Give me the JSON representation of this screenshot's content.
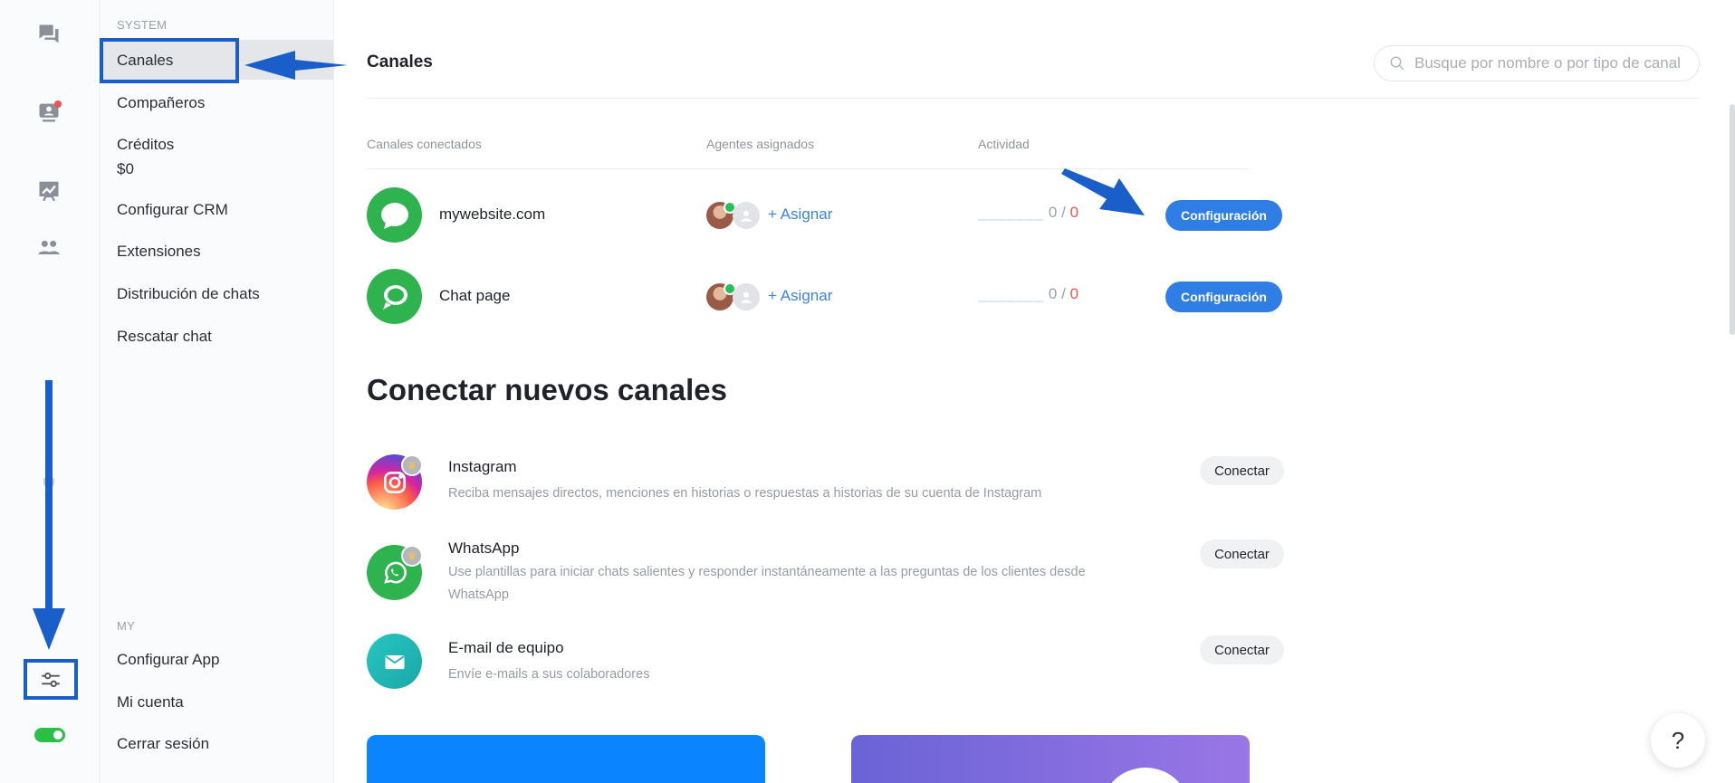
{
  "menu": {
    "system_label": "SYSTEM",
    "items": [
      {
        "label": "Canales"
      },
      {
        "label": "Compañeros"
      },
      {
        "label": "Créditos"
      },
      {
        "label": "Configurar CRM"
      },
      {
        "label": "Extensiones"
      },
      {
        "label": "Distribución de chats"
      },
      {
        "label": "Rescatar chat"
      }
    ],
    "credits_value": "$0",
    "my_label": "MY",
    "my_items": [
      {
        "label": "Configurar App"
      },
      {
        "label": "Mi cuenta"
      },
      {
        "label": "Cerrar sesión"
      }
    ]
  },
  "header": {
    "title": "Canales",
    "search_placeholder": "Busque por nombre o por tipo de canal"
  },
  "table": {
    "columns": [
      "Canales conectados",
      "Agentes asignados",
      "Actividad"
    ],
    "rows": [
      {
        "name": "mywebsite.com",
        "assign": "+ Asignar",
        "dashes": "_______",
        "count": "0",
        "sep": " / ",
        "total": "0",
        "button": "Configuración"
      },
      {
        "name": "Chat page",
        "assign": "+ Asignar",
        "dashes": "_______",
        "count": "0",
        "sep": " / ",
        "total": "0",
        "button": "Configuración"
      }
    ]
  },
  "new_channels": {
    "heading": "Conectar nuevos canales",
    "items": [
      {
        "title": "Instagram",
        "desc": "Reciba mensajes directos, menciones en historias o respuestas a historias de su cuenta de Instagram",
        "button": "Conectar"
      },
      {
        "title": "WhatsApp",
        "desc": "Use plantillas para iniciar chats salientes y responder instantáneamente a las preguntas de los clientes desde WhatsApp",
        "button": "Conectar"
      },
      {
        "title": "E-mail de equipo",
        "desc": "Envíe e-mails a sus colaboradores",
        "button": "Conectar"
      }
    ]
  },
  "help": {
    "label": "?"
  },
  "icons": [
    "chat-icon",
    "visitors-icon",
    "analytics-icon",
    "team-icon",
    "settings-sliders-icon",
    "search-icon",
    "crown-icon"
  ],
  "colors": {
    "accent": "#2f7ee6",
    "whatsapp_green": "#2fb34f",
    "annotation_blue": "#1a5fc9",
    "toggle_green": "#2bbf4a"
  }
}
